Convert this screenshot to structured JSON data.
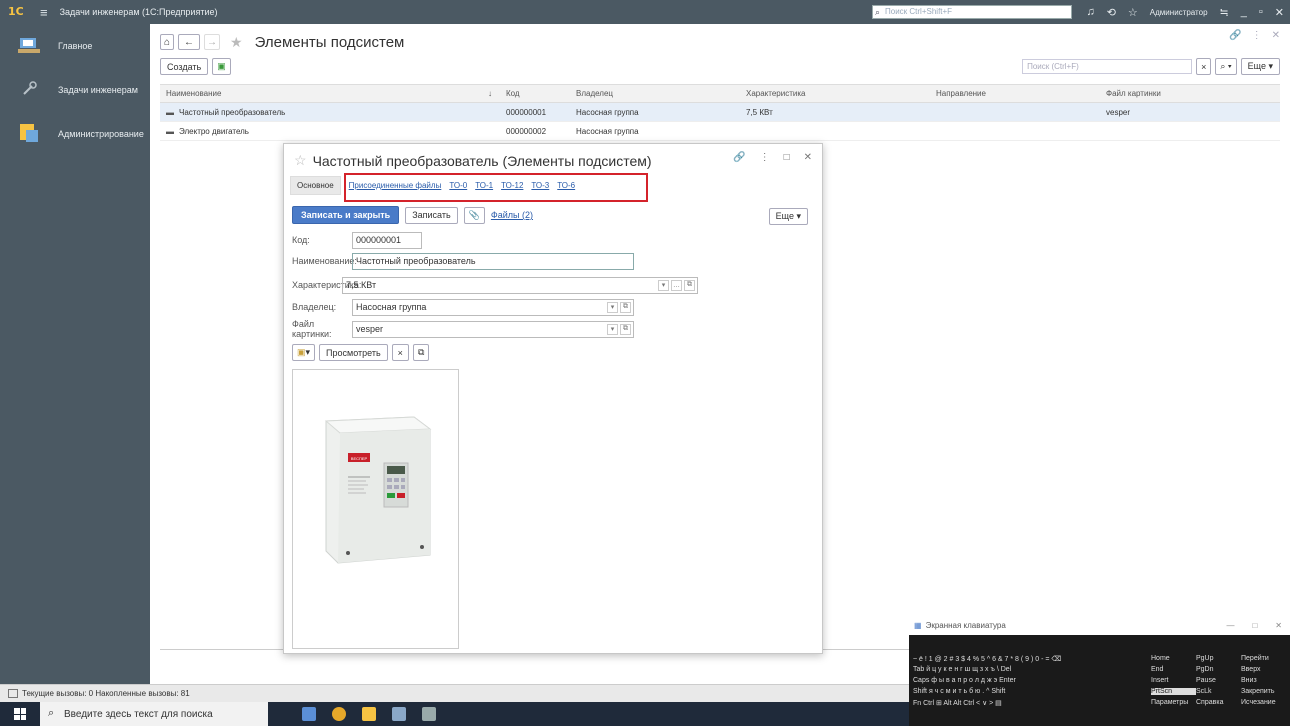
{
  "titlebar": {
    "app_title": "Задачи инженерам (1С:Предприятие)",
    "search_placeholder": "Поиск Ctrl+Shift+F",
    "user": "Администратор"
  },
  "sidebar": {
    "items": [
      {
        "label": "Главное"
      },
      {
        "label": "Задачи инженерам"
      },
      {
        "label": "Администрирование"
      }
    ]
  },
  "page": {
    "title": "Элементы подсистем",
    "create_label": "Создать",
    "search_placeholder": "Поиск (Ctrl+F)",
    "more_label": "Еще ▾"
  },
  "table": {
    "headers": [
      "Наименование",
      "Код",
      "Владелец",
      "Характеристика",
      "Направление",
      "Файл картинки"
    ],
    "rows": [
      {
        "name": "Частотный преобразователь",
        "code": "000000001",
        "owner": "Насосная группа",
        "char": "7,5 КВт",
        "dir": "",
        "file": "vesper"
      },
      {
        "name": "Электро двигатель",
        "code": "000000002",
        "owner": "Насосная группа",
        "char": "",
        "dir": "",
        "file": ""
      }
    ]
  },
  "dialog": {
    "title": "Частотный преобразователь (Элементы подсистем)",
    "tabs": {
      "main": "Основное",
      "files": "Присоединенные файлы",
      "t0": "ТО-0",
      "t1": "ТО-1",
      "t12": "ТО-12",
      "t3": "ТО-3",
      "t6": "ТО-6"
    },
    "save_close": "Записать и закрыть",
    "save": "Записать",
    "files_link": "Файлы (2)",
    "more": "Еще ▾",
    "fields": {
      "code_label": "Код:",
      "code_value": "000000001",
      "name_label": "Наименование:",
      "name_value": "Частотный преобразователь",
      "char_label": "Характеристика:",
      "char_value": "7,5 КВт",
      "owner_label": "Владелец:",
      "owner_value": "Насосная группа",
      "file_label": "Файл картинки:",
      "file_value": "vesper"
    },
    "view_label": "Просмотреть",
    "device_brand": "ВЕСПЕР"
  },
  "status": {
    "text": "Текущие вызовы: 0   Накопленные вызовы: 81"
  },
  "taskbar": {
    "search_text": "Введите здесь текст для поиска"
  },
  "keyboard": {
    "title": "Экранная клавиатура",
    "rows": [
      "~ ё  ! 1  @ 2  # 3  $ 4  % 5  ^ 6  & 7  * 8  ( 9  ) 0  -  = ⌫",
      "Tab  й  ц  у  к  е  н  г  ш  щ  з  х  ъ  \\  Del",
      "Caps  ф  ы  в  а  п  р  о  л  д  ж  э  Enter",
      "Shift  я  ч  с  м  и  т  ь  б  ю  .  ^  Shift",
      "Fn  Ctrl  ⊞  Alt                Alt  Ctrl  <  ∨  >  ▤"
    ],
    "right_rows": [
      [
        "Home",
        "PgUp",
        "Перейти"
      ],
      [
        "End",
        "PgDn",
        "Вверх"
      ],
      [
        "Insert",
        "Pause",
        "Вниз"
      ],
      [
        "PrtScn",
        "ScLk",
        "Закрепить"
      ],
      [
        "Параметры",
        "Справка",
        "Исчезание"
      ]
    ]
  },
  "colors": {
    "chrome": "#4b5963",
    "primary_button": "#4a7bc8",
    "highlight_box": "#d4232b",
    "selected_row": "#e6eef8"
  }
}
